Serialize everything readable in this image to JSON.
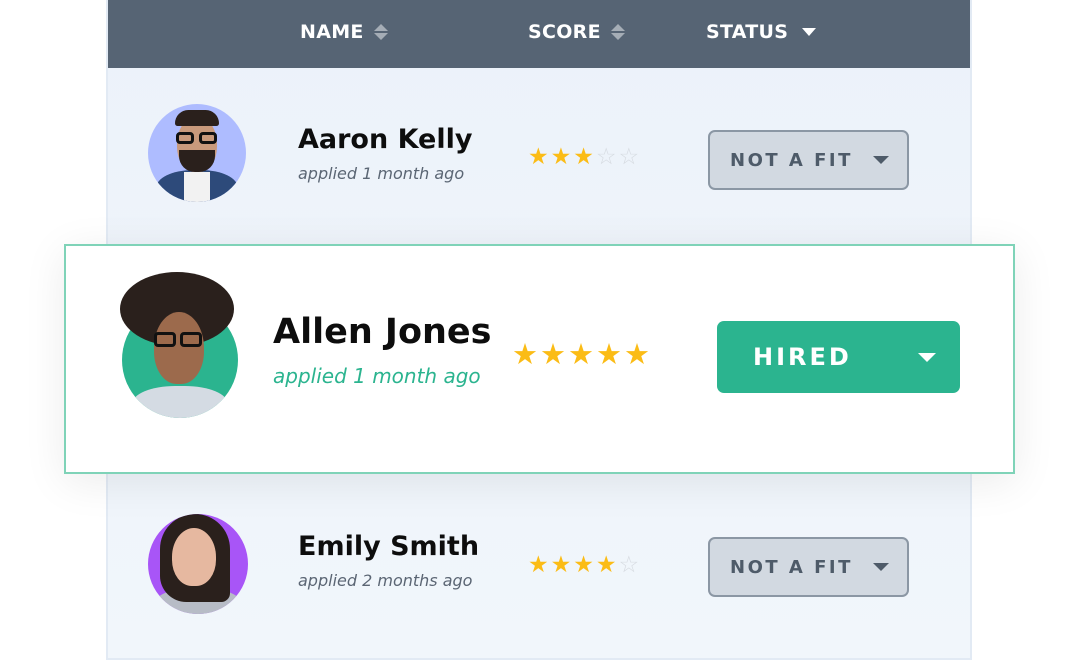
{
  "header": {
    "columns": [
      {
        "label": "NAME",
        "icon": "sort-icon"
      },
      {
        "label": "SCORE",
        "icon": "sort-icon"
      },
      {
        "label": "STATUS",
        "icon": "caret-down-icon"
      }
    ]
  },
  "candidates": [
    {
      "name": "Aaron Kelly",
      "applied": "applied 1 month ago",
      "rating": 3,
      "rating_max": 5,
      "status": "NOT A FIT",
      "avatar_bg": "#aebcff",
      "highlighted": false
    },
    {
      "name": "Allen Jones",
      "applied": "applied 1 month ago",
      "rating": 5,
      "rating_max": 5,
      "status": "HIRED",
      "avatar_bg": "#2bb48f",
      "highlighted": true
    },
    {
      "name": "Emily Smith",
      "applied": "applied 2 months ago",
      "rating": 4,
      "rating_max": 5,
      "status": "NOT A FIT",
      "avatar_bg": "#a855f7",
      "highlighted": false
    }
  ],
  "colors": {
    "header_bg": "#566474",
    "accent_green": "#2bb48f",
    "star_filled": "#fbbc16",
    "star_empty": "#d6dbe1",
    "status_gray_bg": "#d2d9e1"
  },
  "star_glyph": "★",
  "star_empty_glyph": "☆"
}
